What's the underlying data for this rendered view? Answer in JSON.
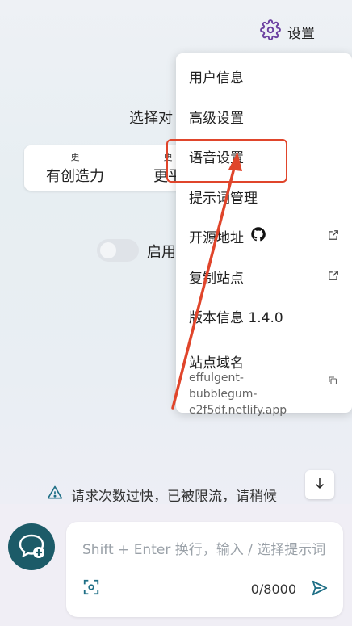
{
  "header": {
    "settings_label": "设置"
  },
  "main": {
    "select_label": "选择对",
    "style_options": [
      {
        "small": "更",
        "big": "有创造力"
      },
      {
        "small": "更",
        "big": "更平"
      }
    ],
    "toggle_label": "启用"
  },
  "menu": {
    "items": [
      {
        "label": "用户信息"
      },
      {
        "label": "高级设置"
      },
      {
        "label": "语音设置"
      },
      {
        "label": "提示词管理"
      },
      {
        "label": "开源地址"
      },
      {
        "label": "复制站点"
      },
      {
        "label": "版本信息 1.4.0"
      },
      {
        "label": "站点域名"
      }
    ],
    "domain_value": "effulgent-bubblegum-e2f5df.netlify.app"
  },
  "warning": {
    "text": "请求次数过快，已被限流，请稍候"
  },
  "composer": {
    "placeholder": "Shift + Enter 换行，输入 / 选择提示词",
    "counter": "0/8000"
  },
  "colors": {
    "accent": "#1c5b68",
    "highlight": "#e0452b",
    "link": "#1f6f86"
  }
}
